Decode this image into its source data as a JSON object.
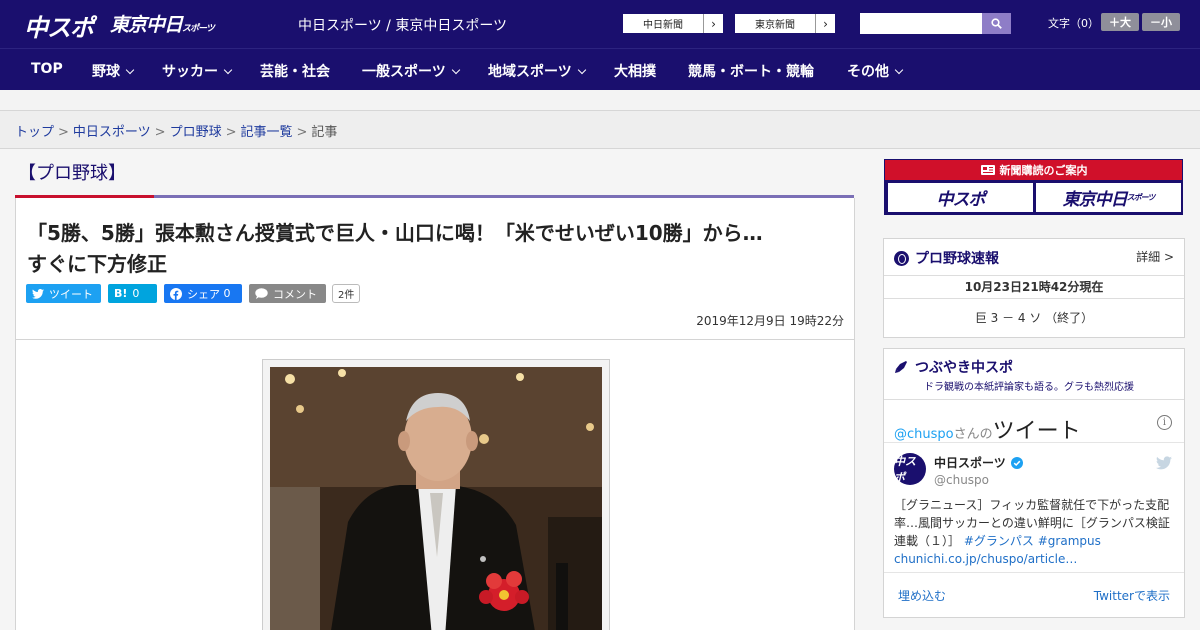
{
  "header": {
    "logo_chuspo": "中スポ",
    "logo_tokyo": "東京中日",
    "logo_tokyo_small": "スポーツ",
    "site_names": "中日スポーツ / 東京中日スポーツ",
    "paper_links": [
      {
        "label": "中日新聞",
        "arrow": "›"
      },
      {
        "label": "東京新聞",
        "arrow": "›"
      }
    ],
    "search": {
      "placeholder": "",
      "value": ""
    },
    "font_size": {
      "label": "文字（0）",
      "bigger": "＋大",
      "smaller": "－小"
    }
  },
  "nav": {
    "items": [
      {
        "label": "TOP",
        "has_menu": false
      },
      {
        "label": "野球",
        "has_menu": true
      },
      {
        "label": "サッカー",
        "has_menu": true
      },
      {
        "label": "芸能・社会",
        "has_menu": false
      },
      {
        "label": "一般スポーツ",
        "has_menu": true
      },
      {
        "label": "地域スポーツ",
        "has_menu": true
      },
      {
        "label": "大相撲",
        "has_menu": false
      },
      {
        "label": "競馬・ボート・競輪",
        "has_menu": false
      },
      {
        "label": "その他",
        "has_menu": true
      }
    ]
  },
  "breadcrumb": {
    "items": [
      "トップ",
      "中日スポーツ",
      "プロ野球",
      "記事一覧"
    ],
    "current": "記事",
    "separator": ">"
  },
  "article": {
    "category": "【プロ野球】",
    "headline_line1": "「5勝、5勝」張本勲さん授賞式で巨人・山口に喝！「米でせいぜい10勝」から…",
    "headline_line2": "すぐに下方修正",
    "share": {
      "tweet": "ツイート",
      "hatena_icon": "B!",
      "hatena_count": "0",
      "facebook": "シェア",
      "facebook_count": "0",
      "comment": "コメント",
      "comment_count": "2件"
    },
    "date": "2019年12月9日 19時22分"
  },
  "sidebar": {
    "subscribe": {
      "title": "新聞購読のご案内",
      "logo_chuspo": "中スポ",
      "logo_tokyo": "東京中日",
      "logo_tokyo_small": "スポーツ"
    },
    "scores": {
      "title": "プロ野球速報",
      "detail": "詳細 >",
      "timestamp": "10月23日21時42分現在",
      "game": "巨 3 － 4 ソ （終了）"
    },
    "tweets": {
      "title": "つぶやき中スポ",
      "subtitle": "ドラ観戦の本紙評論家も語る。グラも熱烈応援",
      "handle": "@chuspo",
      "handle_suffix": "さんの",
      "tweet_word": "ツイート",
      "info": "i",
      "account_name": "中日スポーツ",
      "avatar_text": "中スポ",
      "account_handle": "@chuspo",
      "text": "［グラニュース］フィッカ監督就任で下がった支配率…風間サッカーとの違い鮮明に［グランパス検証連載（１）］",
      "tag1": "#グランパス",
      "tag2": "#grampus",
      "link": "chunichi.co.jp/chuspo/article…",
      "embed": "埋め込む",
      "view": "Twitterで表示"
    }
  },
  "colors": {
    "brand_navy": "#1a0f6e",
    "accent_red": "#c8102e",
    "accent_purple": "#7b6fb6",
    "twitter_blue": "#1da1f2",
    "facebook_blue": "#1877f2",
    "hatena_blue": "#00a4de"
  }
}
